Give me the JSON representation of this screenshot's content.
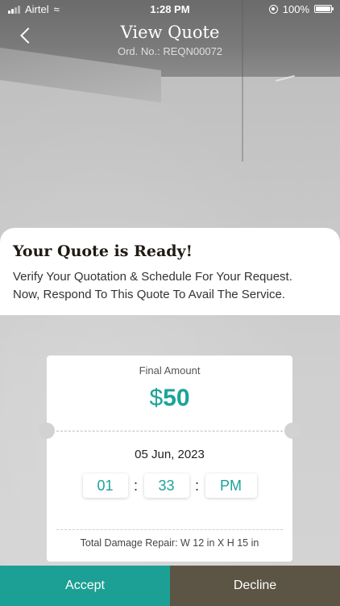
{
  "status_bar": {
    "carrier": "Airtel",
    "time": "1:28 PM",
    "battery": "100%"
  },
  "header": {
    "title": "View Quote",
    "order_no": "Ord. No.: REQN00072"
  },
  "quote": {
    "title": "Your Quote is Ready!",
    "line1": "Verify Your Quotation & Schedule For Your Request.",
    "line2": "Now, Respond To This Quote To Avail The Service."
  },
  "ticket": {
    "final_label": "Final Amount",
    "currency": "$",
    "amount": "50",
    "date": "05 Jun, 2023",
    "hour": "01",
    "minute": "33",
    "ampm": "PM",
    "damage": "Total Damage Repair: W 12 in X H 15 in"
  },
  "actions": {
    "accept_label": "Accept",
    "decline_label": "Decline"
  },
  "colors": {
    "accent": "#1c9f94",
    "decline": "#5c5444"
  }
}
